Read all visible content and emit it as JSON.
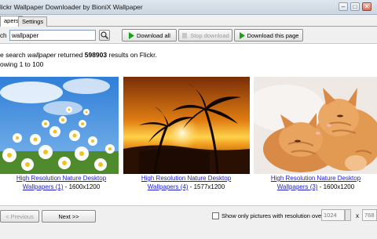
{
  "window": {
    "title": "lickr Wallpaper Downloader by BioniX Wallpaper",
    "minimize_glyph": "–",
    "maximize_glyph": "□",
    "close_glyph": "✕"
  },
  "tabs": [
    {
      "label": "apers"
    },
    {
      "label": "Settings"
    }
  ],
  "search": {
    "label": "ch",
    "value": "wallpaper"
  },
  "toolbar": {
    "download_all": "Download all",
    "stop_download": "Stop download",
    "download_page": "Download this page"
  },
  "results": {
    "prefix": "e search ",
    "term": "wallpaper",
    "mid": " returned ",
    "count": "598903",
    "suffix": " results on Flickr.",
    "showing": "owing 1 to 100"
  },
  "images": [
    {
      "link": "High Resolution Nature Desktop Wallpapers (1)",
      "size": " - 1600x1200"
    },
    {
      "link": "High Resolution Nature Desktop Wallpapers (4)",
      "size": " - 1577x1200"
    },
    {
      "link": "High Resolution Nature Desktop Wallpapers (3)",
      "size": " - 1600x1200"
    }
  ],
  "bottom": {
    "prev": "< Previous",
    "next": "Next >>",
    "filter_label": "Show only pictures with resolution over:",
    "width": "1024",
    "times": "x",
    "height": "768"
  },
  "colors": {
    "link": "#1c1ccc",
    "play": "#1aa11a"
  }
}
